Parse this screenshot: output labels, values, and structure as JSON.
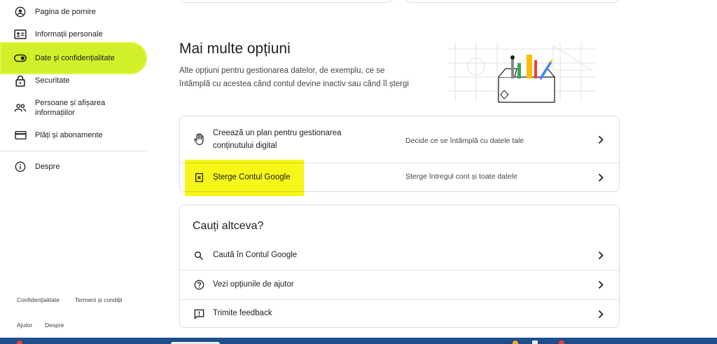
{
  "sidebar": {
    "items": [
      {
        "label": "Pagina de pornire",
        "icon": "account-circle-icon"
      },
      {
        "label": "Informații personale",
        "icon": "id-card-icon"
      },
      {
        "label": "Date și confidențialitate",
        "icon": "toggle-icon",
        "active": true
      },
      {
        "label": "Securitate",
        "icon": "lock-icon"
      },
      {
        "label": "Persoane și afișarea informațiilor",
        "label_line1": "Persoane și afișarea",
        "label_line2": "informațiilor",
        "icon": "people-icon"
      },
      {
        "label": "Plăți și abonamente",
        "icon": "credit-card-icon"
      },
      {
        "label": "Despre",
        "icon": "info-icon"
      }
    ],
    "footer": {
      "privacy": "Confidențialitate",
      "terms": "Termeni și condiții",
      "help": "Ajutor",
      "about": "Despre"
    }
  },
  "more_options": {
    "title": "Mai multe opțiuni",
    "description": "Alte opțiuni pentru gestionarea datelor, de exemplu, ce se întâmplă cu acestea când contul devine inactiv sau când îl ștergi",
    "rows": [
      {
        "label_line1": "Creează un plan pentru gestionarea",
        "label_line2": "conținutului digital",
        "desc": "Decide ce se întâmplă cu datele tale",
        "icon": "hand-icon"
      },
      {
        "label": "Șterge Contul Google",
        "desc": "Șterge întregul cont și toate datele",
        "icon": "delete-box-icon"
      }
    ]
  },
  "looking_for": {
    "title": "Cauți altceva?",
    "rows": [
      {
        "label": "Caută în Contul Google",
        "icon": "search-icon"
      },
      {
        "label": "Vezi opțiunile de ajutor",
        "icon": "help-circle-icon"
      },
      {
        "label": "Trimite feedback",
        "icon": "feedback-icon"
      }
    ]
  },
  "colors": {
    "highlight": "#d2f02a",
    "highlight_yellow": "#f5f500",
    "taskbar": "#1f4e8c",
    "border": "#dadce0"
  }
}
